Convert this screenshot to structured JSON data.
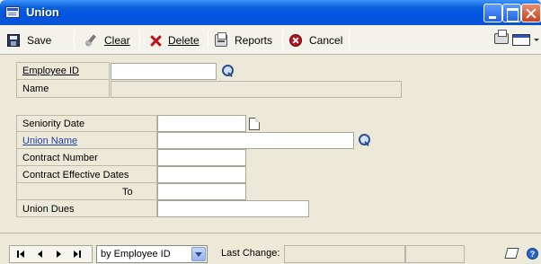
{
  "window": {
    "title": "Union"
  },
  "toolbar": {
    "save_label": "Save",
    "clear_label": "Clear",
    "delete_label": "Delete",
    "reports_label": "Reports",
    "cancel_label": "Cancel"
  },
  "form": {
    "employee_id": {
      "label": "Employee ID",
      "value": ""
    },
    "name": {
      "label": "Name",
      "value": ""
    },
    "seniority_date": {
      "label": "Seniority Date",
      "value": ""
    },
    "union_name": {
      "label": "Union Name",
      "value": ""
    },
    "contract_number": {
      "label": "Contract Number",
      "value": ""
    },
    "contract_effective_dates": {
      "label": "Contract Effective Dates",
      "value": ""
    },
    "to": {
      "label": "To",
      "value": ""
    },
    "union_dues": {
      "label": "Union Dues",
      "value": ""
    }
  },
  "bottombar": {
    "sort_by": "by Employee ID",
    "last_change_label": "Last Change:"
  },
  "icons": {
    "title": "window-app-icon",
    "save": "disk-icon",
    "clear": "eraser-icon",
    "delete": "red-x-icon",
    "reports": "printer-icon",
    "cancel": "stop-icon",
    "lookup": "magnifier-icon",
    "date": "calendar-note-icon",
    "help": "help-icon"
  },
  "colors": {
    "titlebar": "#0054e3",
    "window_bg": "#ece9d8",
    "link": "#1f3fa6",
    "cancel_red": "#b2141a"
  }
}
